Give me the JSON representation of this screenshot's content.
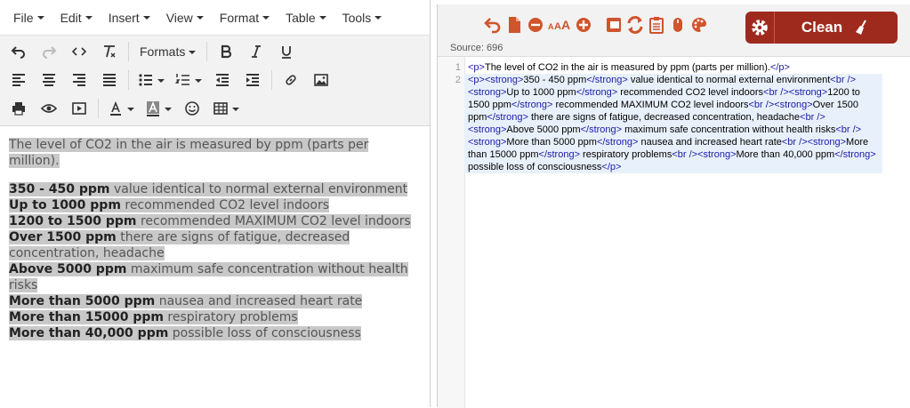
{
  "menubar": {
    "items": [
      {
        "label": "File"
      },
      {
        "label": "Edit"
      },
      {
        "label": "Insert"
      },
      {
        "label": "View"
      },
      {
        "label": "Format"
      },
      {
        "label": "Table"
      },
      {
        "label": "Tools"
      }
    ]
  },
  "toolbar": {
    "formats_label": "Formats"
  },
  "editor": {
    "p1": "The level of CO2 in the air is measured by ppm (parts per million).",
    "lines": [
      {
        "bold": "350 - 450 ppm",
        "text": " value identical to normal external environment"
      },
      {
        "bold": "Up to 1000 ppm",
        "text": " recommended CO2 level indoors"
      },
      {
        "bold": "1200 to 1500 ppm",
        "text": " recommended MAXIMUM CO2 level indoors"
      },
      {
        "bold": "Over 1500 ppm",
        "text": " there are signs of fatigue, decreased concentration, headache"
      },
      {
        "bold": "Above 5000 ppm",
        "text": " maximum safe concentration without health risks"
      },
      {
        "bold": "More than 5000 ppm",
        "text": " nausea and increased heart rate"
      },
      {
        "bold": "More than 15000 ppm",
        "text": " respiratory problems"
      },
      {
        "bold": "More than 40,000 ppm",
        "text": " possible loss of consciousness"
      }
    ]
  },
  "source_panel": {
    "clean_label": "Clean",
    "source_label": "Source: 696",
    "line_numbers": [
      "1",
      "2"
    ],
    "accent": "#9e2a1e",
    "icon_color": "#d0542c"
  }
}
